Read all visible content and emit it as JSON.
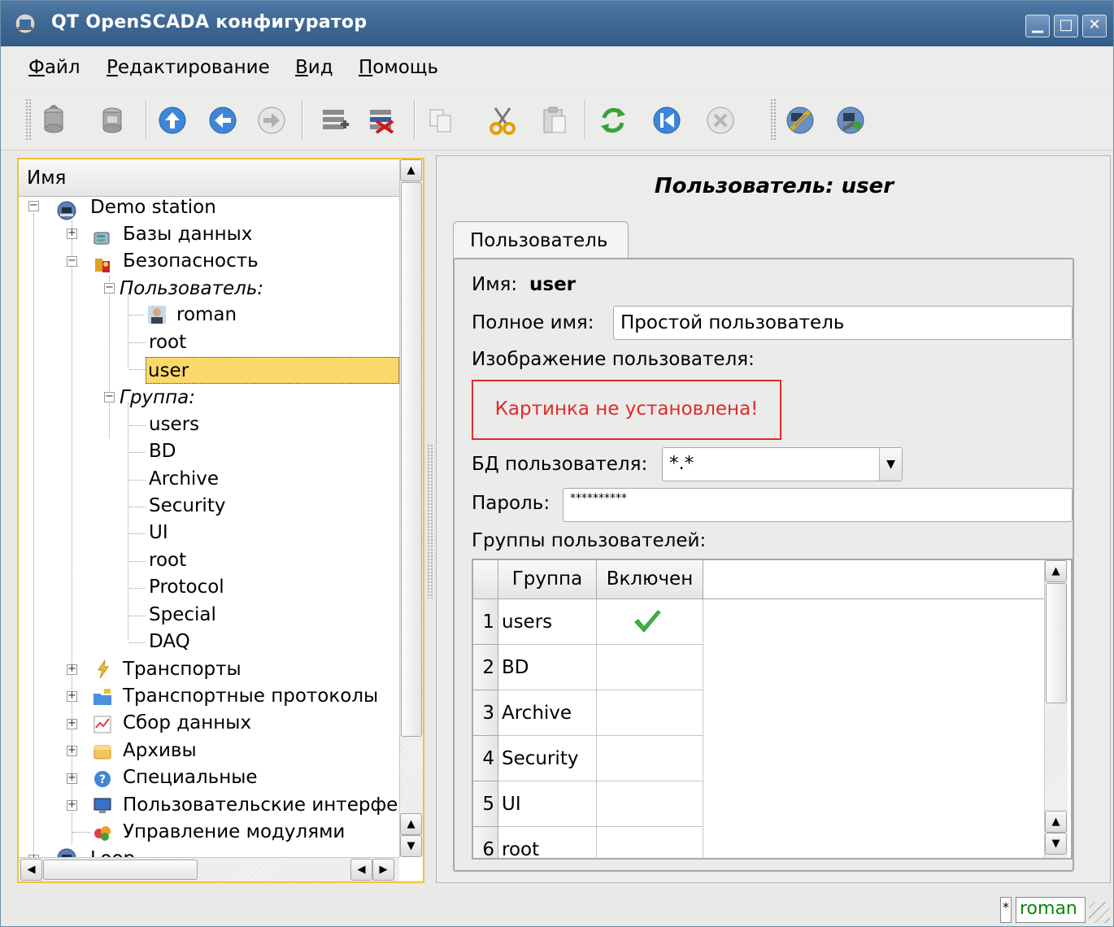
{
  "window": {
    "title": "QT OpenSCADA конфигуратор"
  },
  "menu": [
    {
      "label_u": "Ф",
      "label_rest": "айл"
    },
    {
      "label_u": "Р",
      "label_rest": "едактирование"
    },
    {
      "label_u": "В",
      "label_rest": "ид"
    },
    {
      "label_u": "П",
      "label_rest": "омощь"
    }
  ],
  "toolbar": {
    "icons": [
      "db-load-icon",
      "db-save-icon",
      "up-icon",
      "back-icon",
      "forward-icon",
      "add-item-icon",
      "delete-item-icon",
      "copy-icon",
      "cut-icon",
      "paste-icon",
      "refresh-icon",
      "start-icon",
      "stop-icon",
      "station-config-icon",
      "station-icon"
    ]
  },
  "tree": {
    "header": "Имя",
    "items": {
      "demo": "Demo station",
      "db": "Базы данных",
      "security": "Безопасность",
      "users_group": "Пользователь:",
      "roman": "roman",
      "root": "root",
      "user": "user",
      "group": "Группа:",
      "g_users": "users",
      "g_bd": "BD",
      "g_archive": "Archive",
      "g_security": "Security",
      "g_ui": "UI",
      "g_root": "root",
      "g_protocol": "Protocol",
      "g_special": "Special",
      "g_daq": "DAQ",
      "transports": "Транспорты",
      "protocols": "Транспортные протоколы",
      "daq": "Сбор данных",
      "archives": "Архивы",
      "special": "Специальные",
      "ui": "Пользовательские интерфе",
      "modules": "Управление модулями",
      "loop": "Loop"
    }
  },
  "page": {
    "title": "Пользователь: user",
    "tab": "Пользователь",
    "name_label": "Имя:",
    "name_value": "user",
    "fullname_label": "Полное имя:",
    "fullname_value": "Простой пользователь",
    "picture_label": "Изображение пользователя:",
    "picture_missing": "Картинка не установлена!",
    "db_label": "БД пользователя:",
    "db_value": "*.*",
    "password_label": "Пароль:",
    "password_value": "**********",
    "groups_label": "Группы пользователей:",
    "groups_table": {
      "columns": [
        "Группа",
        "Включен"
      ],
      "rows": [
        {
          "num": "1",
          "group": "users",
          "enabled": true
        },
        {
          "num": "2",
          "group": "BD",
          "enabled": false
        },
        {
          "num": "3",
          "group": "Archive",
          "enabled": false
        },
        {
          "num": "4",
          "group": "Security",
          "enabled": false
        },
        {
          "num": "5",
          "group": "UI",
          "enabled": false
        },
        {
          "num": "6",
          "group": "root",
          "enabled": false
        }
      ]
    }
  },
  "status": {
    "modified": "*",
    "user": "roman"
  },
  "colors": {
    "selection": "#fbd86a",
    "focus_border": "#f0c23a",
    "error": "#e02a2a",
    "user_status": "#0a8a0a"
  }
}
